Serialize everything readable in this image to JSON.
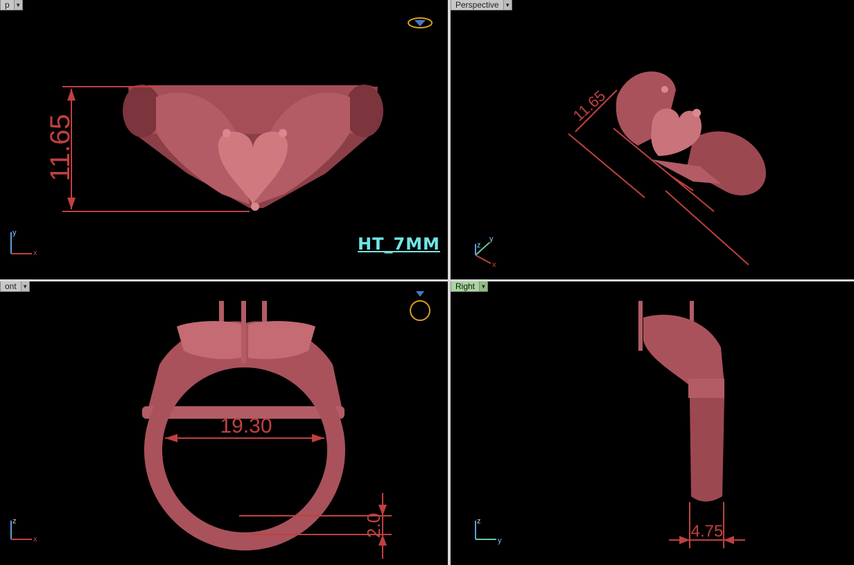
{
  "viewports": {
    "top": {
      "tab_label": "p"
    },
    "perspective": {
      "tab_label": "Perspective"
    },
    "front": {
      "tab_label": "ont"
    },
    "right": {
      "tab_label": "Right"
    }
  },
  "model_label": "HT_7MM",
  "dimensions": {
    "top_height": "11.65",
    "perspective_height": "11.65",
    "front_inner_diameter": "19.30",
    "front_band_thickness": "2.0",
    "right_band_width": "4.75"
  },
  "axes": {
    "top": {
      "a": "y",
      "b": "x"
    },
    "perspective": {
      "a": "z",
      "b": "y",
      "c": "x"
    },
    "front": {
      "a": "z",
      "b": "x"
    },
    "right": {
      "a": "z",
      "b": "y"
    }
  },
  "colors": {
    "ring": "#b05a62",
    "dimension": "#c04040",
    "label": "#6fe6e6",
    "active_tab": "#a9d69e"
  }
}
